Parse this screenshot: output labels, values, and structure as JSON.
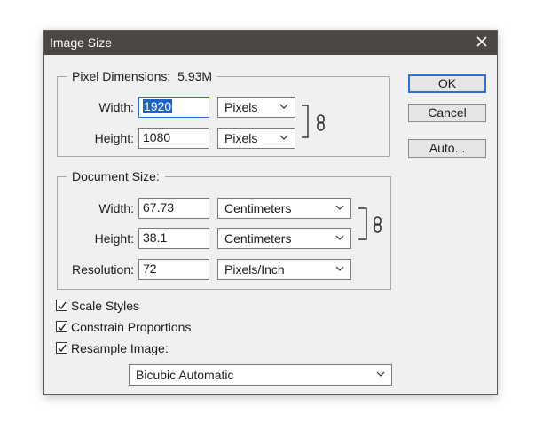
{
  "window": {
    "title": "Image Size",
    "close_icon": "close-icon"
  },
  "pixel_dimensions": {
    "label": "Pixel Dimensions:",
    "size": "5.93M",
    "width_label": "Width:",
    "width_value": "1920",
    "width_unit": "Pixels",
    "height_label": "Height:",
    "height_value": "1080",
    "height_unit": "Pixels",
    "link_icon": "chain-link-icon"
  },
  "document_size": {
    "label": "Document Size:",
    "width_label": "Width:",
    "width_value": "67.73",
    "width_unit": "Centimeters",
    "height_label": "Height:",
    "height_value": "38.1",
    "height_unit": "Centimeters",
    "resolution_label": "Resolution:",
    "resolution_value": "72",
    "resolution_unit": "Pixels/Inch",
    "link_icon": "chain-link-icon"
  },
  "options": {
    "scale_styles": {
      "label": "Scale Styles",
      "checked": true
    },
    "constrain_proportions": {
      "label": "Constrain Proportions",
      "checked": true
    },
    "resample_image": {
      "label": "Resample Image:",
      "checked": true
    },
    "resample_method": "Bicubic Automatic"
  },
  "buttons": {
    "ok": "OK",
    "cancel": "Cancel",
    "auto": "Auto..."
  },
  "colors": {
    "titlebar": "#4a4744",
    "dialog_bg": "#f0f0f0",
    "selection": "#1f63c7",
    "default_button_border": "#2f6fd0"
  }
}
